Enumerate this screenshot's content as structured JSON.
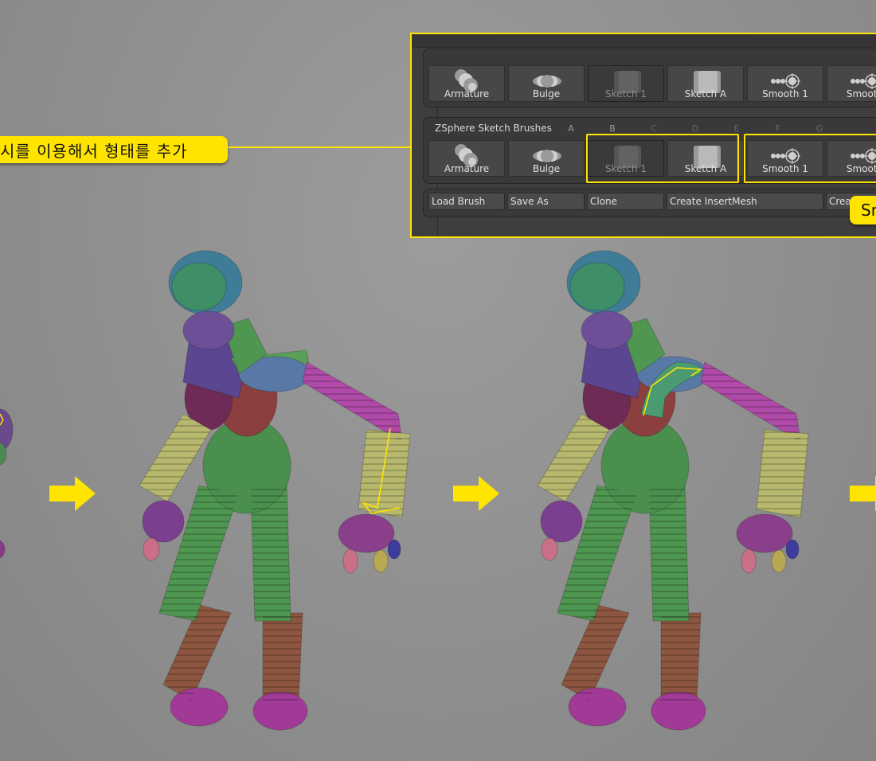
{
  "callout_left": {
    "text": "시를 이용해서 형태를 추가"
  },
  "callout_right": {
    "text": "Sm"
  },
  "panel": {
    "top_row": [
      {
        "label": "Armature",
        "icon": "armature-icon",
        "state": "normal"
      },
      {
        "label": "Bulge",
        "icon": "bulge-icon",
        "state": "normal"
      },
      {
        "label": "Sketch 1",
        "icon": "sketch-icon",
        "state": "disabled"
      },
      {
        "label": "Sketch A",
        "icon": "sketch-icon",
        "state": "normal"
      },
      {
        "label": "Smooth 1",
        "icon": "smooth-icon",
        "state": "normal"
      },
      {
        "label": "Smooth",
        "icon": "smooth-icon",
        "state": "normal"
      }
    ],
    "group_title": "ZSphere Sketch Brushes",
    "slot_letters": [
      "A",
      "B",
      "C",
      "D",
      "E",
      "F",
      "G"
    ],
    "bottom_row": [
      {
        "label": "Armature",
        "icon": "armature-icon",
        "state": "normal"
      },
      {
        "label": "Bulge",
        "icon": "bulge-icon",
        "state": "normal"
      },
      {
        "label": "Sketch 1",
        "icon": "sketch-icon",
        "state": "disabled"
      },
      {
        "label": "Sketch A",
        "icon": "sketch-icon",
        "state": "normal"
      },
      {
        "label": "Smooth 1",
        "icon": "smooth-icon",
        "state": "normal"
      },
      {
        "label": "Smooth",
        "icon": "smooth-icon",
        "state": "normal"
      }
    ],
    "buttons": {
      "load_brush": "Load Brush",
      "save_as": "Save As",
      "clone": "Clone",
      "create_insert_mesh": "Create InsertMesh",
      "create": "Crea"
    }
  },
  "colors": {
    "highlight": "#ffe400",
    "background": "#8f8f8f",
    "panel": "#3e3e3e"
  }
}
